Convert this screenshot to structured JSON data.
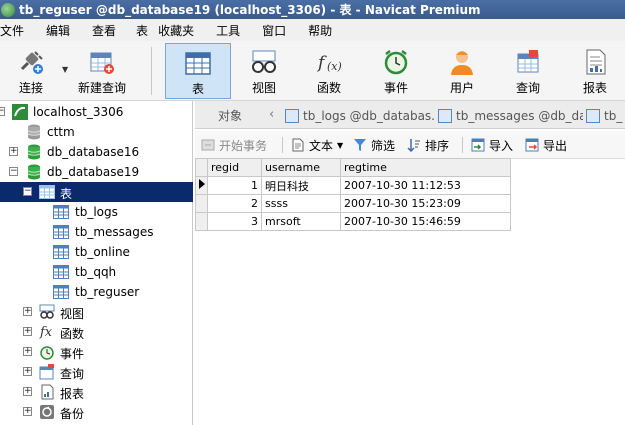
{
  "window": {
    "title": "tb_reguser @db_database19 (localhost_3306) - 表 - Navicat Premium"
  },
  "menu": [
    "文件",
    "编辑",
    "查看",
    "表",
    "收藏夹",
    "工具",
    "窗口",
    "帮助"
  ],
  "toolbar": {
    "connect": "连接",
    "new_query": "新建查询",
    "table": "表",
    "view": "视图",
    "function": "函数",
    "event": "事件",
    "user": "用户",
    "query": "查询",
    "report": "报表"
  },
  "tree": {
    "connection": "localhost_3306",
    "databases": [
      "cttm",
      "db_database16",
      "db_database19"
    ],
    "tables_node": "表",
    "tables": [
      "tb_logs",
      "tb_messages",
      "tb_online",
      "tb_qqh",
      "tb_reguser"
    ],
    "other_nodes": [
      "视图",
      "函数",
      "事件",
      "查询",
      "报表",
      "备份"
    ]
  },
  "tabs": {
    "objects": "对象",
    "open": [
      "tb_logs @db_databas...",
      "tb_messages @db_dat...",
      "tb_"
    ]
  },
  "table_toolbar": {
    "begin_transaction": "开始事务",
    "text": "文本",
    "filter": "筛选",
    "sort": "排序",
    "import": "导入",
    "export": "导出"
  },
  "grid": {
    "columns": [
      "regid",
      "username",
      "regtime"
    ],
    "rows": [
      {
        "regid": "1",
        "username": "明日科技",
        "regtime": "2007-10-30 11:12:53"
      },
      {
        "regid": "2",
        "username": "ssss",
        "regtime": "2007-10-30 15:23:09"
      },
      {
        "regid": "3",
        "username": "mrsoft",
        "regtime": "2007-10-30 15:46:59"
      }
    ]
  }
}
